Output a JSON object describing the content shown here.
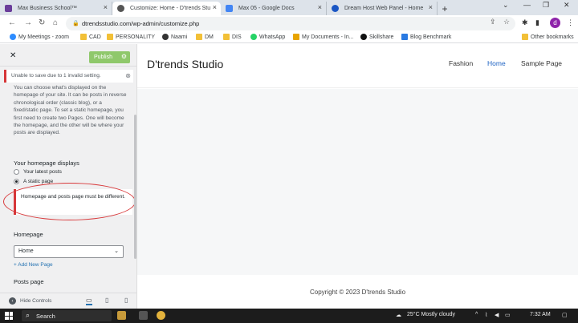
{
  "browser": {
    "tabs": [
      {
        "title": "Max Business School™",
        "fav_color": "#6a3d9a"
      },
      {
        "title": "Customize: Home - D'trends Stu",
        "fav_color": "#555555"
      },
      {
        "title": "Max 05 - Google Docs",
        "fav_color": "#4285f4"
      },
      {
        "title": "Dream Host Web Panel - Home",
        "fav_color": "#1a56c4"
      }
    ],
    "new_tab": "+",
    "url": "dtrendsstudio.com/wp-admin/customize.php",
    "avatar_letter": "d",
    "bookmarks": [
      {
        "label": "My Meetings - zoom",
        "icon": "zoom",
        "color": "#2d8cff"
      },
      {
        "label": "CAD",
        "icon": "folder"
      },
      {
        "label": "PERSONALITY",
        "icon": "folder"
      },
      {
        "label": "Naami",
        "icon": "naami",
        "color": "#333333"
      },
      {
        "label": "DM",
        "icon": "folder"
      },
      {
        "label": "DIS",
        "icon": "folder"
      },
      {
        "label": "WhatsApp",
        "icon": "whatsapp",
        "color": "#25d366"
      },
      {
        "label": "My Documents - In...",
        "icon": "docs",
        "color": "#e8a400"
      },
      {
        "label": "Skillshare",
        "icon": "skillshare",
        "color": "#111111"
      },
      {
        "label": "Blog Benchmark",
        "icon": "blog",
        "color": "#2a7ae2"
      }
    ],
    "other_bookmarks": "Other bookmarks"
  },
  "customizer": {
    "publish_label": "Publish",
    "notice": "Unable to save due to 1 invalid setting.",
    "description": "You can choose what's displayed on the homepage of your site. It can be posts in reverse chronological order (classic blog), or a fixed/static page. To set a static homepage, you first need to create two Pages. One will become the homepage, and the other will be where your posts are displayed.",
    "displays_label": "Your homepage displays",
    "radio_latest": "Your latest posts",
    "radio_static": "A static page",
    "error_message": "Homepage and posts page must be different.",
    "homepage_label": "Homepage",
    "homepage_value": "Home",
    "add_new_page": "+ Add New Page",
    "posts_page_label": "Posts page",
    "hide_controls": "Hide Controls"
  },
  "preview": {
    "site_title": "D'trends Studio",
    "nav": [
      "Fashion",
      "Home",
      "Sample Page"
    ],
    "footer": "Copyright © 2023 D'trends Studio"
  },
  "taskbar": {
    "search": "Search",
    "weather": "25°C  Mostly cloudy",
    "time": "7:32 AM"
  }
}
